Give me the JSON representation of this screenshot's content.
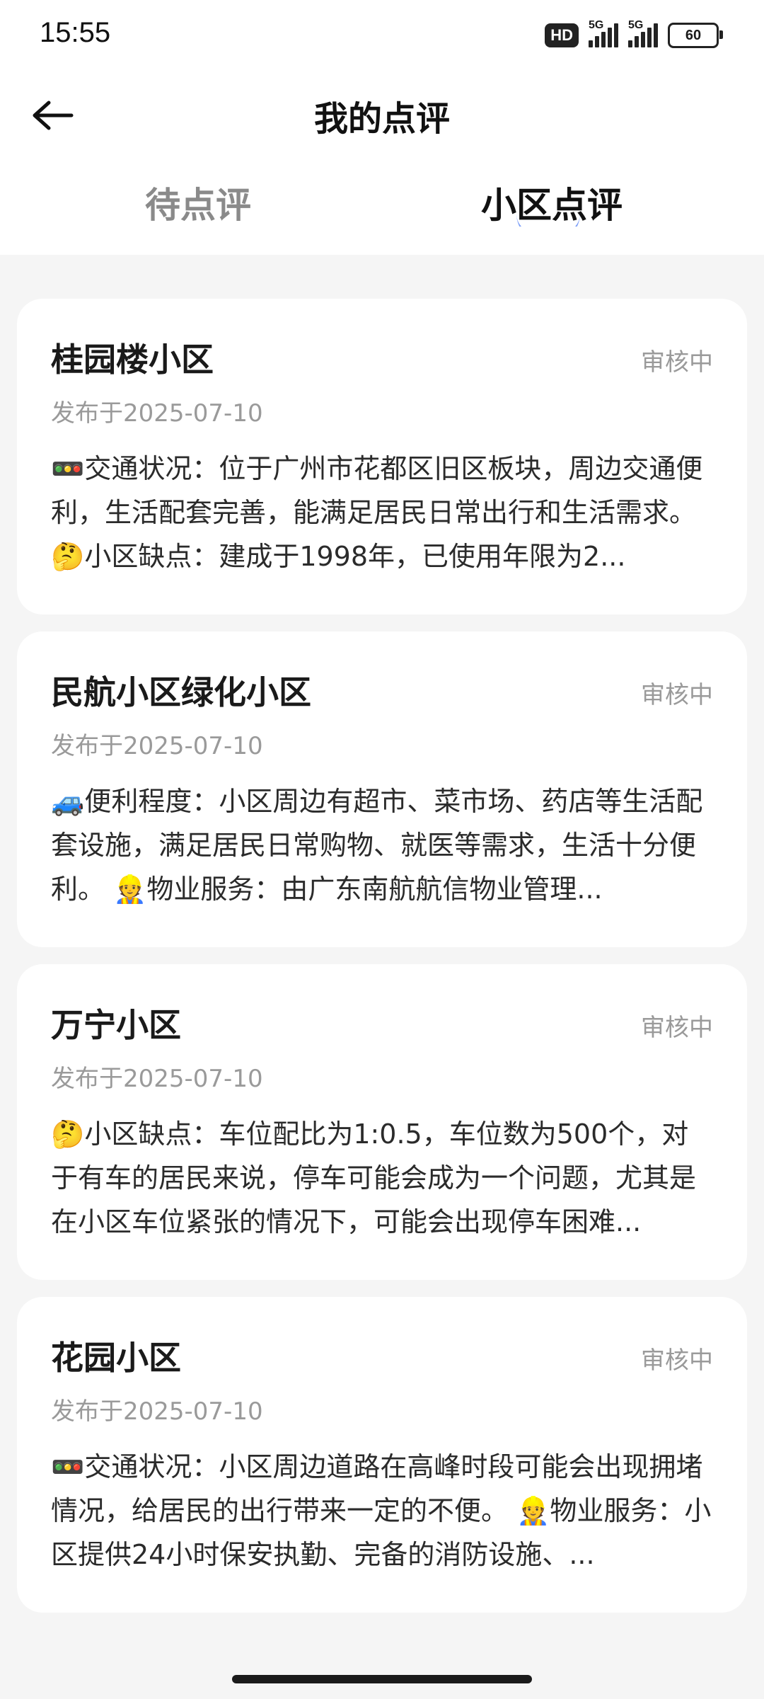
{
  "status_bar": {
    "time": "15:55",
    "hd": "HD",
    "net1": "5G",
    "net2": "5G",
    "battery": "60"
  },
  "header": {
    "title": "我的点评"
  },
  "tabs": [
    {
      "label": "待点评",
      "active": false
    },
    {
      "label": "小区点评",
      "active": true
    }
  ],
  "reviews": [
    {
      "title": "桂园楼小区",
      "status": "审核中",
      "date": "发布于2025-07-10",
      "content": "🚥交通状况：位于广州市花都区旧区板块，周边交通便利，生活配套完善，能满足居民日常出行和生活需求。 🤔小区缺点：建成于1998年，已使用年限为2..."
    },
    {
      "title": "民航小区绿化小区",
      "status": "审核中",
      "date": "发布于2025-07-10",
      "content": "🚙便利程度：小区周边有超市、菜市场、药店等生活配套设施，满足居民日常购物、就医等需求，生活十分便利。 👷物业服务：由广东南航航信物业管理..."
    },
    {
      "title": "万宁小区",
      "status": "审核中",
      "date": "发布于2025-07-10",
      "content": "🤔小区缺点：车位配比为1:0.5，车位数为500个，对于有车的居民来说，停车可能会成为一个问题，尤其是在小区车位紧张的情况下，可能会出现停车困难..."
    },
    {
      "title": "花园小区",
      "status": "审核中",
      "date": "发布于2025-07-10",
      "content": "🚥交通状况：小区周边道路在高峰时段可能会出现拥堵情况，给居民的出行带来一定的不便。 👷物业服务：小区提供24小时保安执勤、完备的消防设施、..."
    }
  ],
  "colors": {
    "accent": "#4f7df6",
    "background": "#f5f5f5",
    "card": "#ffffff",
    "muted_text": "#9a9a9a"
  }
}
